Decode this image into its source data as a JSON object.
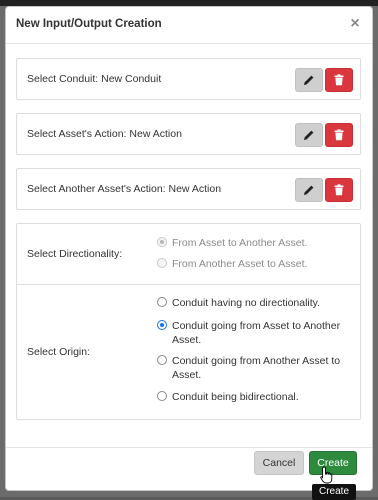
{
  "dialog": {
    "title": "New Input/Output Creation",
    "close_symbol": "×"
  },
  "selections": [
    {
      "label": "Select Conduit: New Conduit"
    },
    {
      "label": "Select Asset's Action: New Action"
    },
    {
      "label": "Select Another Asset's Action: New Action"
    }
  ],
  "directionality": {
    "label": "Select Directionality:",
    "options": [
      {
        "text": "From Asset to Another Asset.",
        "checked": true,
        "disabled": true
      },
      {
        "text": "From Another Asset to Asset.",
        "checked": false,
        "disabled": true
      }
    ]
  },
  "origin": {
    "label": "Select Origin:",
    "options": [
      {
        "text": "Conduit having no directionality.",
        "checked": false
      },
      {
        "text": "Conduit going from Asset to Another Asset.",
        "checked": true
      },
      {
        "text": "Conduit going from Another Asset to Asset.",
        "checked": false
      },
      {
        "text": "Conduit being bidirectional.",
        "checked": false
      }
    ]
  },
  "footer": {
    "cancel_label": "Cancel",
    "create_label": "Create",
    "tooltip": "Create"
  },
  "colors": {
    "danger": "#d9363e",
    "success": "#2e8b3e",
    "radio_accent": "#1a73e8"
  },
  "icons": {
    "edit": "pencil-icon",
    "delete": "trash-icon",
    "close": "close-icon"
  }
}
